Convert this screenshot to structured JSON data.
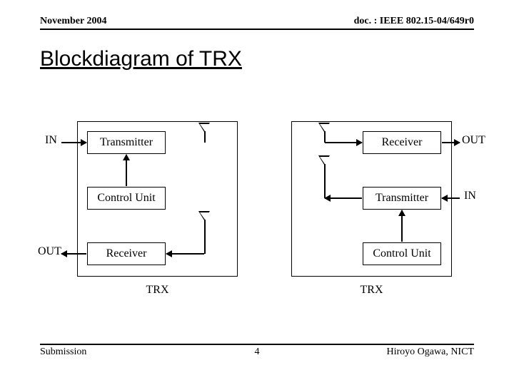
{
  "header": {
    "date": "November 2004",
    "docref": "doc. : IEEE 802.15-04/649r0"
  },
  "title": "Blockdiagram of TRX",
  "diagram": {
    "left": {
      "label": "TRX",
      "in_label": "IN",
      "out_label": "OUT",
      "blocks": {
        "tx": "Transmitter",
        "cu": "Control Unit",
        "rx": "Receiver"
      }
    },
    "right": {
      "label": "TRX",
      "in_label": "IN",
      "out_label": "OUT",
      "blocks": {
        "rx": "Receiver",
        "tx": "Transmitter",
        "cu": "Control Unit"
      }
    }
  },
  "footer": {
    "left": "Submission",
    "page": "4",
    "right": "Hiroyo Ogawa, NICT"
  }
}
